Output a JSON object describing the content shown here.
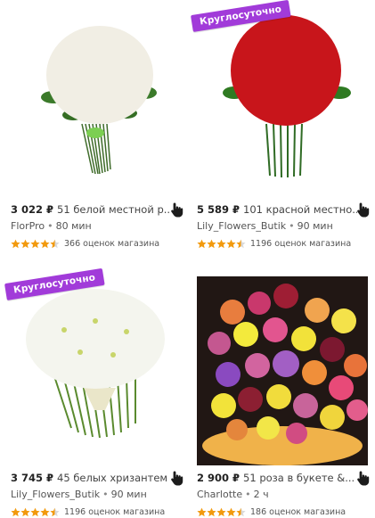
{
  "products": [
    {
      "price": "3 022 ₽",
      "name": "51 белой местной р...",
      "shop": "FlorPro",
      "delivery": "80 мин",
      "reviews": "366 оценок магазина",
      "rating": 4.5,
      "badge": "",
      "photo": "white-roses-bouquet"
    },
    {
      "price": "5 589 ₽",
      "name": "101 красной местно...",
      "shop": "Lily_Flowers_Butik",
      "delivery": "90 мин",
      "reviews": "1196 оценок магазина",
      "rating": 4.5,
      "badge": "Круглосуточно",
      "photo": "red-roses-bouquet"
    },
    {
      "price": "3 745 ₽",
      "name": "45 белых хризантем",
      "shop": "Lily_Flowers_Butik",
      "delivery": "90 мин",
      "reviews": "1196 оценок магазина",
      "rating": 4.5,
      "badge": "Круглосуточно",
      "photo": "white-chrysanthemums-bouquet"
    },
    {
      "price": "2 900 ₽",
      "name": "51 роза в букете &...",
      "shop": "Charlotte",
      "delivery": "2 ч",
      "reviews": "186 оценок магазина",
      "rating": 4.5,
      "badge": "",
      "photo": "mixed-roses-bouquet"
    }
  ],
  "separator": "•",
  "colors": {
    "badge": "#a13bd9",
    "star": "#f29a0e",
    "star_empty": "#d9d9d9"
  },
  "icons": {
    "hand": "hand-pointer-icon",
    "star": "star-icon"
  }
}
